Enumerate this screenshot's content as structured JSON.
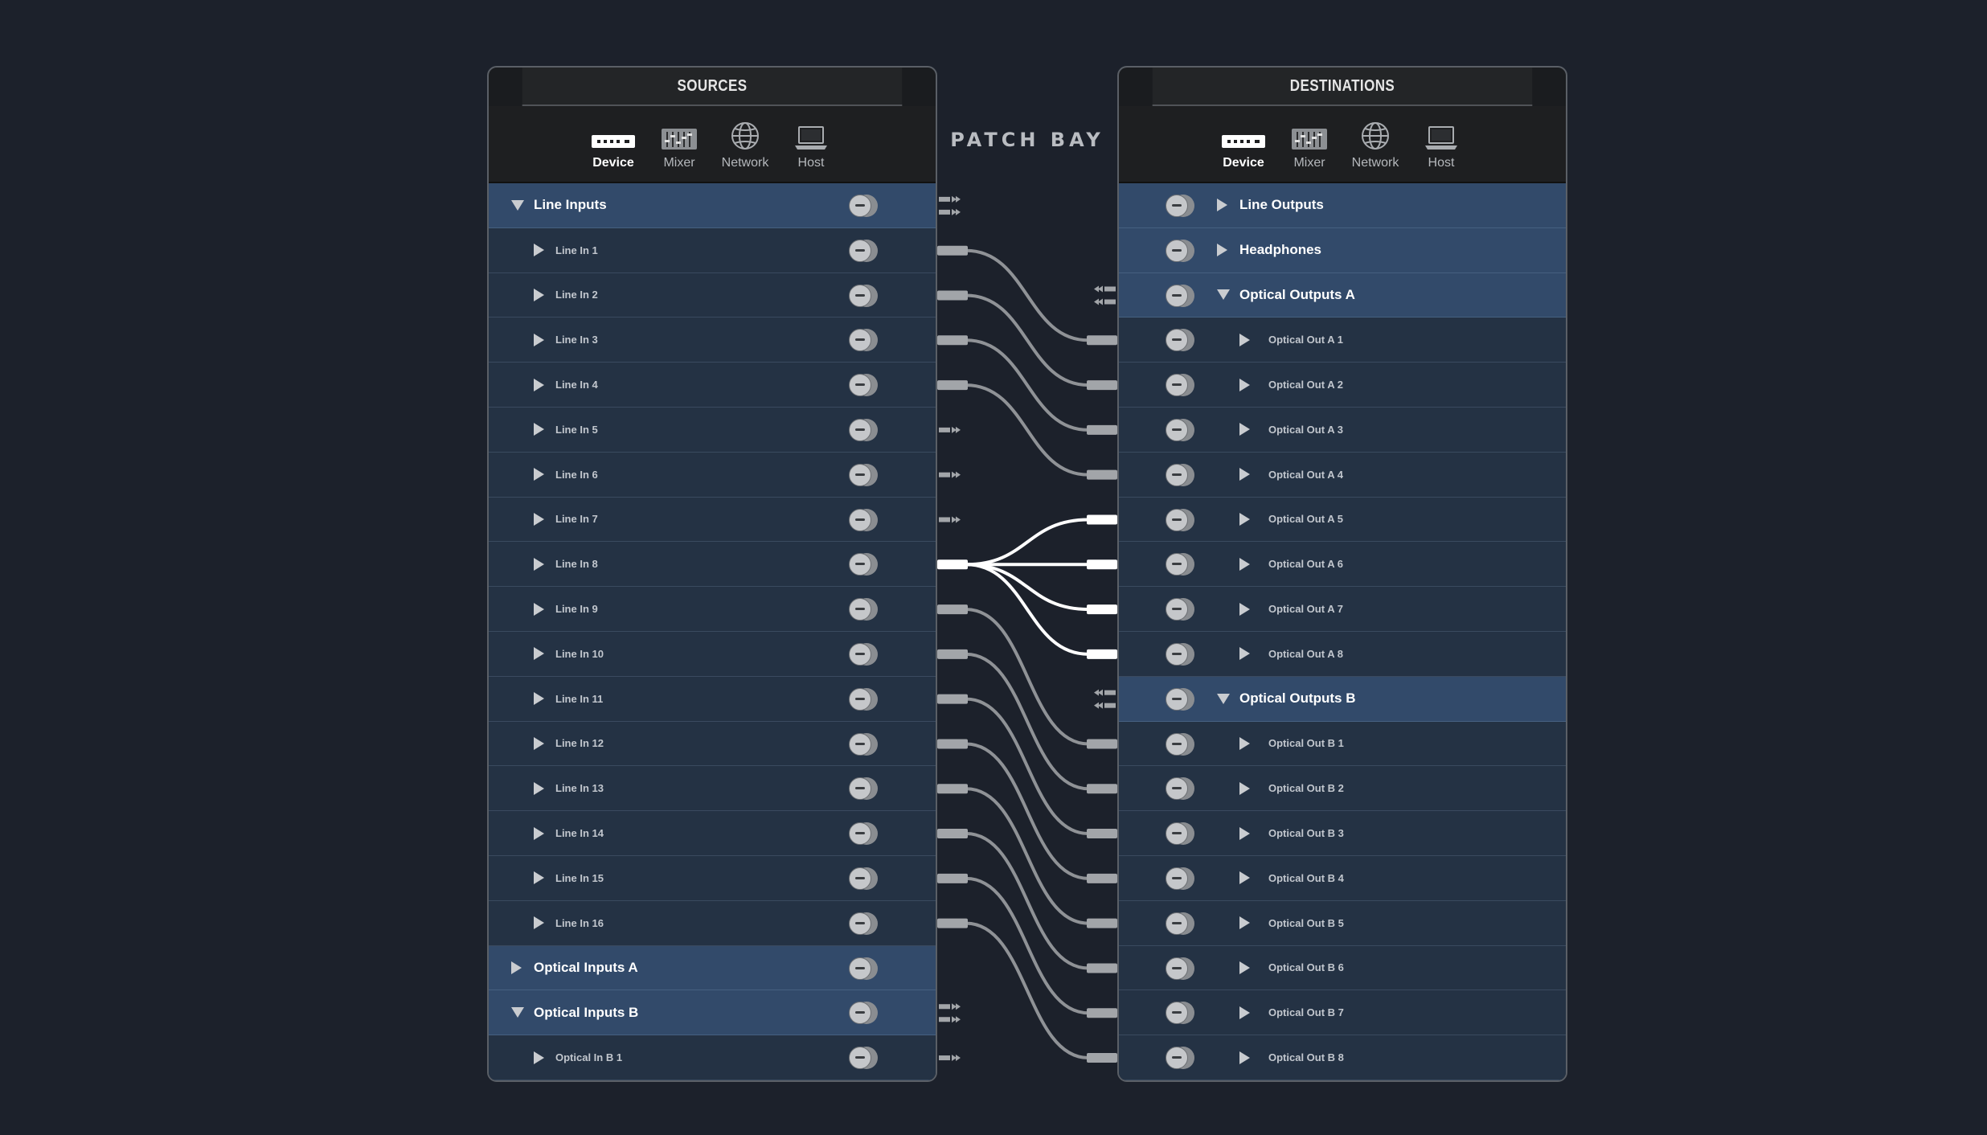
{
  "patch_bay_title": "PATCH BAY",
  "tabs": [
    {
      "label": "Device",
      "icon": "device-icon",
      "active": true
    },
    {
      "label": "Mixer",
      "icon": "mixer-icon",
      "active": false
    },
    {
      "label": "Network",
      "icon": "globe-icon",
      "active": false
    },
    {
      "label": "Host",
      "icon": "laptop-icon",
      "active": false
    }
  ],
  "sources": {
    "title": "SOURCES",
    "rows": [
      {
        "type": "group",
        "label": "Line Inputs",
        "expanded": true
      },
      {
        "type": "item",
        "label": "Line In 1"
      },
      {
        "type": "item",
        "label": "Line In 2"
      },
      {
        "type": "item",
        "label": "Line In 3"
      },
      {
        "type": "item",
        "label": "Line In 4"
      },
      {
        "type": "item",
        "label": "Line In 5"
      },
      {
        "type": "item",
        "label": "Line In 6"
      },
      {
        "type": "item",
        "label": "Line In 7"
      },
      {
        "type": "item",
        "label": "Line In 8"
      },
      {
        "type": "item",
        "label": "Line In 9"
      },
      {
        "type": "item",
        "label": "Line In 10"
      },
      {
        "type": "item",
        "label": "Line In 11"
      },
      {
        "type": "item",
        "label": "Line In 12"
      },
      {
        "type": "item",
        "label": "Line In 13"
      },
      {
        "type": "item",
        "label": "Line In 14"
      },
      {
        "type": "item",
        "label": "Line In 15"
      },
      {
        "type": "item",
        "label": "Line In 16"
      },
      {
        "type": "group",
        "label": "Optical Inputs A",
        "expanded": false
      },
      {
        "type": "group",
        "label": "Optical Inputs B",
        "expanded": true
      },
      {
        "type": "item",
        "label": "Optical In B 1"
      }
    ]
  },
  "destinations": {
    "title": "DESTINATIONS",
    "rows": [
      {
        "type": "group",
        "label": "Line Outputs",
        "expanded": false
      },
      {
        "type": "group",
        "label": "Headphones",
        "expanded": false
      },
      {
        "type": "group",
        "label": "Optical Outputs A",
        "expanded": true
      },
      {
        "type": "item",
        "label": "Optical Out A 1"
      },
      {
        "type": "item",
        "label": "Optical Out A 2"
      },
      {
        "type": "item",
        "label": "Optical Out A 3"
      },
      {
        "type": "item",
        "label": "Optical Out A 4"
      },
      {
        "type": "item",
        "label": "Optical Out A 5"
      },
      {
        "type": "item",
        "label": "Optical Out A 6"
      },
      {
        "type": "item",
        "label": "Optical Out A 7"
      },
      {
        "type": "item",
        "label": "Optical Out A 8"
      },
      {
        "type": "group",
        "label": "Optical Outputs B",
        "expanded": true
      },
      {
        "type": "item",
        "label": "Optical Out B 1"
      },
      {
        "type": "item",
        "label": "Optical Out B 2"
      },
      {
        "type": "item",
        "label": "Optical Out B 3"
      },
      {
        "type": "item",
        "label": "Optical Out B 4"
      },
      {
        "type": "item",
        "label": "Optical Out B 5"
      },
      {
        "type": "item",
        "label": "Optical Out B 6"
      },
      {
        "type": "item",
        "label": "Optical Out B 7"
      },
      {
        "type": "item",
        "label": "Optical Out B 8"
      }
    ]
  },
  "connections": [
    {
      "from": "Line In 1",
      "to": "Optical Out A 1"
    },
    {
      "from": "Line In 2",
      "to": "Optical Out A 2"
    },
    {
      "from": "Line In 3",
      "to": "Optical Out A 3"
    },
    {
      "from": "Line In 4",
      "to": "Optical Out A 4"
    },
    {
      "from": "Line In 8",
      "to": "Optical Out A 5",
      "highlighted": true
    },
    {
      "from": "Line In 8",
      "to": "Optical Out A 6",
      "highlighted": true
    },
    {
      "from": "Line In 8",
      "to": "Optical Out A 7",
      "highlighted": true
    },
    {
      "from": "Line In 8",
      "to": "Optical Out A 8",
      "highlighted": true
    },
    {
      "from": "Line In 9",
      "to": "Optical Out B 1"
    },
    {
      "from": "Line In 10",
      "to": "Optical Out B 2"
    },
    {
      "from": "Line In 11",
      "to": "Optical Out B 3"
    },
    {
      "from": "Line In 12",
      "to": "Optical Out B 4"
    },
    {
      "from": "Line In 13",
      "to": "Optical Out B 5"
    },
    {
      "from": "Line In 14",
      "to": "Optical Out B 6"
    },
    {
      "from": "Line In 15",
      "to": "Optical Out B 7"
    },
    {
      "from": "Line In 16",
      "to": "Optical Out B 8"
    }
  ],
  "colors": {
    "background": "#1c212b",
    "group_row": "#324a6a",
    "item_row": "#243244",
    "cable": "#8f9296",
    "cable_highlight": "#ffffff"
  }
}
